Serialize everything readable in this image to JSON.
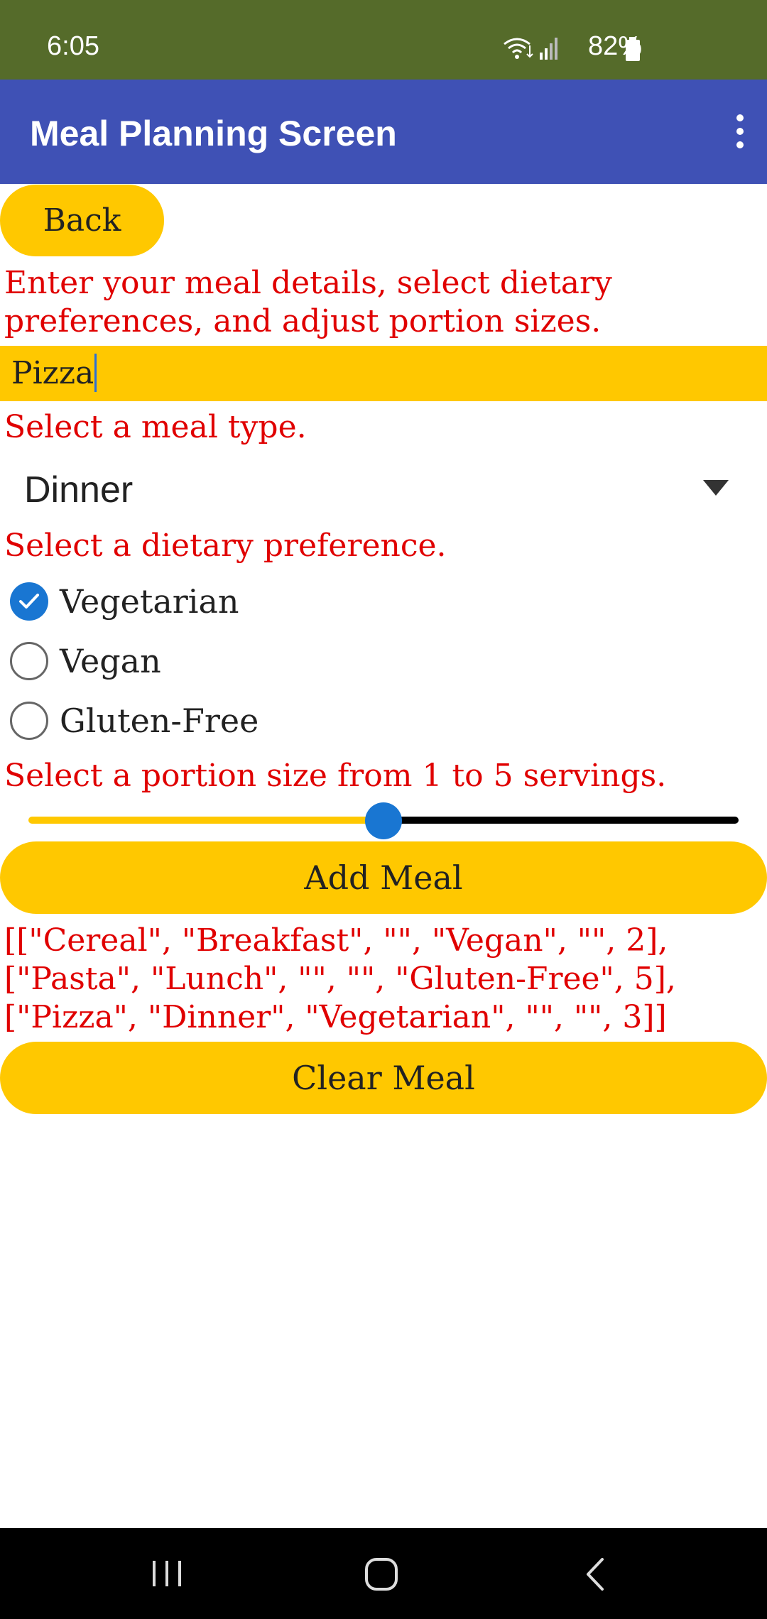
{
  "status_bar": {
    "time": "6:05",
    "battery": "82%"
  },
  "app_bar": {
    "title": "Meal Planning Screen"
  },
  "back_button": {
    "label": "Back"
  },
  "instructions": "Enter your meal details, select dietary preferences, and adjust portion sizes.",
  "meal_input": {
    "value": "Pizza"
  },
  "meal_type": {
    "label": "Select a meal type.",
    "selected": "Dinner"
  },
  "dietary": {
    "label": "Select a dietary preference.",
    "options": [
      {
        "label": "Vegetarian",
        "checked": true
      },
      {
        "label": "Vegan",
        "checked": false
      },
      {
        "label": "Gluten-Free",
        "checked": false
      }
    ]
  },
  "portion": {
    "label": "Select a portion size from 1 to 5 servings.",
    "min": 1,
    "max": 5,
    "value": 3
  },
  "add_button": {
    "label": "Add Meal"
  },
  "meal_list": {
    "lines": [
      "[[\"Cereal\", \"Breakfast\", \"\", \"Vegan\", \"\", 2],",
      "[\"Pasta\", \"Lunch\", \"\", \"\", \"Gluten-Free\", 5],",
      "[\"Pizza\", \"Dinner\", \"Vegetarian\", \"\", \"\", 3]]"
    ]
  },
  "clear_button": {
    "label": "Clear Meal"
  },
  "colors": {
    "status_bar": "#556b2a",
    "app_bar": "#3f51b5",
    "accent_yellow": "#ffc800",
    "text_red": "#e00000",
    "control_blue": "#1976d2"
  },
  "icons": {
    "wifi": "wifi-icon",
    "signal": "signal-icon",
    "battery": "battery-icon",
    "overflow": "overflow-menu-icon",
    "dropdown": "dropdown-arrow-icon",
    "checkmark": "checkmark-icon",
    "recents": "recents-icon",
    "home": "home-icon",
    "back": "back-nav-icon"
  }
}
